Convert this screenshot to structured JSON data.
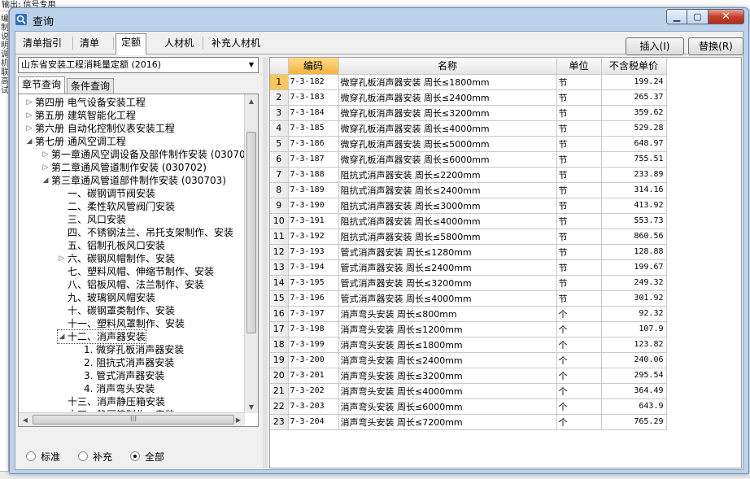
{
  "background": {
    "top_text": "输出: 信号专用",
    "left_text": "编制说明调机联高试"
  },
  "window": {
    "title": "查询",
    "minimize_label": "▁",
    "maximize_label": "▢",
    "close_label": "✕"
  },
  "tabs": [
    {
      "label": "清单指引"
    },
    {
      "label": "清单"
    },
    {
      "label": "定额"
    },
    {
      "label": "人材机"
    },
    {
      "label": "补充人材机"
    }
  ],
  "active_tab": "定额",
  "buttons": {
    "insert_label": "插入(I)",
    "replace_label": "替换(R)"
  },
  "quota_library": {
    "selected": "山东省安装工程消耗量定额 (2016)"
  },
  "subtabs": [
    {
      "label": "章节查询"
    },
    {
      "label": "条件查询"
    }
  ],
  "tree": [
    {
      "label": "第四册 电气设备安装工程",
      "toggle": "▷"
    },
    {
      "label": "第五册 建筑智能化工程",
      "toggle": "▷"
    },
    {
      "label": "第六册 自动化控制仪表安装工程",
      "toggle": "▷"
    },
    {
      "label": "第七册 通风空调工程",
      "toggle": "◢"
    },
    {
      "label": "第一章通风空调设备及部件制作安装 (030701",
      "toggle": "▷"
    },
    {
      "label": "第二章通风管道制作安装 (030702)",
      "toggle": "▷"
    },
    {
      "label": "第三章通风管道部件制作安装 (030703)",
      "toggle": "◢"
    },
    {
      "label": "一、碳钢调节阀安装",
      "toggle": ""
    },
    {
      "label": "二、柔性软风管阀门安装",
      "toggle": ""
    },
    {
      "label": "三、风口安装",
      "toggle": ""
    },
    {
      "label": "四、不锈钢法兰、吊托支架制作、安装",
      "toggle": ""
    },
    {
      "label": "五、铝制孔板风口安装",
      "toggle": ""
    },
    {
      "label": "六、碳钢风帽制作、安装",
      "toggle": "▷"
    },
    {
      "label": "七、塑料风帽、伸缩节制作、安装",
      "toggle": ""
    },
    {
      "label": "八、铝板风帽、法兰制作、安装",
      "toggle": ""
    },
    {
      "label": "九、玻璃钢风帽安装",
      "toggle": ""
    },
    {
      "label": "十、碳钢罩类制作、安装",
      "toggle": ""
    },
    {
      "label": "十一、塑料风罩制作、安装",
      "toggle": ""
    },
    {
      "label": "十二、消声器安装",
      "toggle": "◢"
    },
    {
      "label": "1. 微穿孔板消声器安装",
      "toggle": ""
    },
    {
      "label": "2. 阻抗式消声器安装",
      "toggle": ""
    },
    {
      "label": "3. 管式消声器安装",
      "toggle": ""
    },
    {
      "label": "4. 消声弯头安装",
      "toggle": ""
    },
    {
      "label": "十三、消声静压箱安装",
      "toggle": ""
    },
    {
      "label": "十四、静压箱制作、安装",
      "toggle": ""
    }
  ],
  "hscroll_grip": "III",
  "filter": {
    "options": [
      "标准",
      "补充",
      "全部"
    ],
    "selected": "全部"
  },
  "grid": {
    "columns": [
      "编码",
      "名称",
      "单位",
      "不含税单价"
    ],
    "rows": [
      {
        "n": "1",
        "code": "7-3-182",
        "name": "微穿孔板消声器安装 周长≤1800mm",
        "unit": "节",
        "price": "199.24"
      },
      {
        "n": "2",
        "code": "7-3-183",
        "name": "微穿孔板消声器安装 周长≤2400mm",
        "unit": "节",
        "price": "265.37"
      },
      {
        "n": "3",
        "code": "7-3-184",
        "name": "微穿孔板消声器安装 周长≤3200mm",
        "unit": "节",
        "price": "359.62"
      },
      {
        "n": "4",
        "code": "7-3-185",
        "name": "微穿孔板消声器安装 周长≤4000mm",
        "unit": "节",
        "price": "529.28"
      },
      {
        "n": "5",
        "code": "7-3-186",
        "name": "微穿孔板消声器安装 周长≤5000mm",
        "unit": "节",
        "price": "648.97"
      },
      {
        "n": "6",
        "code": "7-3-187",
        "name": "微穿孔板消声器安装 周长≤6000mm",
        "unit": "节",
        "price": "755.51"
      },
      {
        "n": "7",
        "code": "7-3-188",
        "name": "阻抗式消声器安装 周长≤2200mm",
        "unit": "节",
        "price": "233.89"
      },
      {
        "n": "8",
        "code": "7-3-189",
        "name": "阻抗式消声器安装 周长≤2400mm",
        "unit": "节",
        "price": "314.16"
      },
      {
        "n": "9",
        "code": "7-3-190",
        "name": "阻抗式消声器安装 周长≤3000mm",
        "unit": "节",
        "price": "413.92"
      },
      {
        "n": "10",
        "code": "7-3-191",
        "name": "阻抗式消声器安装 周长≤4000mm",
        "unit": "节",
        "price": "553.73"
      },
      {
        "n": "11",
        "code": "7-3-192",
        "name": "阻抗式消声器安装 周长≤5800mm",
        "unit": "节",
        "price": "860.56"
      },
      {
        "n": "12",
        "code": "7-3-193",
        "name": "管式消声器安装 周长≤1280mm",
        "unit": "节",
        "price": "128.88"
      },
      {
        "n": "13",
        "code": "7-3-194",
        "name": "管式消声器安装 周长≤2400mm",
        "unit": "节",
        "price": "199.67"
      },
      {
        "n": "14",
        "code": "7-3-195",
        "name": "管式消声器安装 周长≤3200mm",
        "unit": "节",
        "price": "249.32"
      },
      {
        "n": "15",
        "code": "7-3-196",
        "name": "管式消声器安装 周长≤4000mm",
        "unit": "节",
        "price": "301.92"
      },
      {
        "n": "16",
        "code": "7-3-197",
        "name": "消声弯头安装 周长≤800mm",
        "unit": "个",
        "price": "92.32"
      },
      {
        "n": "17",
        "code": "7-3-198",
        "name": "消声弯头安装 周长≤1200mm",
        "unit": "个",
        "price": "107.9"
      },
      {
        "n": "18",
        "code": "7-3-199",
        "name": "消声弯头安装 周长≤1800mm",
        "unit": "个",
        "price": "123.82"
      },
      {
        "n": "19",
        "code": "7-3-200",
        "name": "消声弯头安装 周长≤2400mm",
        "unit": "个",
        "price": "240.06"
      },
      {
        "n": "20",
        "code": "7-3-201",
        "name": "消声弯头安装 周长≤3200mm",
        "unit": "个",
        "price": "295.54"
      },
      {
        "n": "21",
        "code": "7-3-202",
        "name": "消声弯头安装 周长≤4000mm",
        "unit": "个",
        "price": "364.49"
      },
      {
        "n": "22",
        "code": "7-3-203",
        "name": "消声弯头安装 周长≤6000mm",
        "unit": "个",
        "price": "643.9"
      },
      {
        "n": "23",
        "code": "7-3-204",
        "name": "消声弯头安装 周长≤7200mm",
        "unit": "个",
        "price": "765.29"
      }
    ]
  },
  "colors": {
    "window_frame": "#bcd2ea",
    "sorted_header": "#f3b63e",
    "close_button": "#c4402c"
  }
}
